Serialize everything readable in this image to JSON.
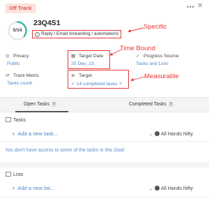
{
  "header": {
    "status": "Off Track",
    "more_icon": "more-dots-icon",
    "close_icon": "close-icon"
  },
  "goal": {
    "progress_text": "5/14",
    "progress_fraction": 0.357,
    "title": "23Q4S1",
    "description": "Reply / Email forwarding / automations"
  },
  "annotations": {
    "specific": "Specific",
    "time_bound": "Time Bound",
    "measurable": "Measurable"
  },
  "fields": {
    "privacy_label": "Privacy",
    "privacy_value": "Public",
    "target_date_label": "Target Date",
    "target_date_value": "20 Dec, 23",
    "progress_source_label": "Progress Source",
    "progress_source_value": "Tasks and Lists",
    "track_metric_label": "Track Metric",
    "track_metric_value": "Tasks count",
    "target_label": "Target",
    "target_value": "14 completed tasks"
  },
  "tabs": [
    {
      "label": "Open Tasks",
      "count": "0"
    },
    {
      "label": "Completed Tasks",
      "count": "0"
    }
  ],
  "tasks": {
    "heading": "Tasks",
    "add_label": "Add a new task...",
    "workspace": "All Hands Nifty",
    "notice": "You don't have access to some of the tasks in this Goal"
  },
  "lists": {
    "heading": "Lists",
    "add_label": "Add a new list...",
    "workspace": "All Hands Nifty"
  },
  "colors": {
    "accent_red": "#e53935",
    "link_blue": "#4a86c8",
    "progress_teal": "#2bb3a3"
  }
}
